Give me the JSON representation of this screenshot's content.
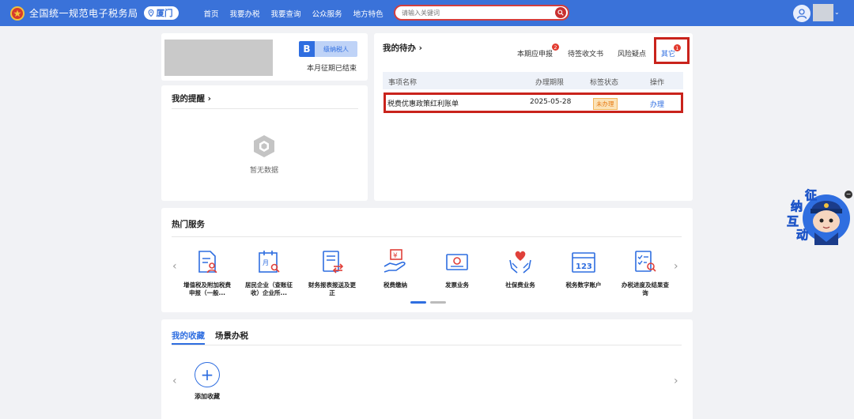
{
  "header": {
    "site_title": "全国统一规范电子税务局",
    "city": "厦门",
    "nav": [
      "首页",
      "我要办税",
      "我要查询",
      "公众服务",
      "地方特色"
    ],
    "search": {
      "placeholder": "请输入关键词"
    }
  },
  "profile": {
    "badge_letter": "B",
    "taxpayer_type": "级纳税人",
    "period_status": "本月征期已结束"
  },
  "reminders": {
    "title": "我的提醒",
    "empty_text": "暂无数据"
  },
  "todo": {
    "title": "我的待办",
    "tabs": [
      {
        "label": "本期应申报",
        "count": "2"
      },
      {
        "label": "待签收文书",
        "count": ""
      },
      {
        "label": "风险疑点",
        "count": ""
      },
      {
        "label": "其它",
        "count": "1"
      }
    ],
    "columns": {
      "name": "事项名称",
      "deadline": "办理期限",
      "status": "标签状态",
      "action": "操作"
    },
    "rows": [
      {
        "name": "税费优惠政策红利账单",
        "deadline": "2025-05-28",
        "status": "未办理",
        "action": "办理"
      }
    ]
  },
  "hot_services": {
    "title": "热门服务",
    "items": [
      {
        "label": "增值税及附加税费申报（一般...",
        "icon": "doc-person-icon"
      },
      {
        "label": "居民企业（查账征收）企业所...",
        "icon": "calendar-search-icon"
      },
      {
        "label": "财务报表报送及更正",
        "icon": "doc-exchange-icon"
      },
      {
        "label": "税费缴纳",
        "icon": "yuan-hand-icon"
      },
      {
        "label": "发票业务",
        "icon": "invoice-icon"
      },
      {
        "label": "社保费业务",
        "icon": "heart-hands-icon"
      },
      {
        "label": "税务数字账户",
        "icon": "calendar-123-icon"
      },
      {
        "label": "办税进度及结果查询",
        "icon": "checklist-search-icon"
      }
    ],
    "prev": "‹",
    "next": "›"
  },
  "favorites": {
    "tabs": [
      "我的收藏",
      "场景办税"
    ],
    "add_label": "添加收藏",
    "prev": "‹",
    "next": "›"
  },
  "mascot": {
    "chars": [
      "征",
      "纳",
      "互",
      "动"
    ]
  },
  "colors": {
    "brand_blue": "#3a72d9",
    "highlight_red": "#c9231c",
    "badge_red": "#e23a2e",
    "status_orange": "#e77b16"
  }
}
